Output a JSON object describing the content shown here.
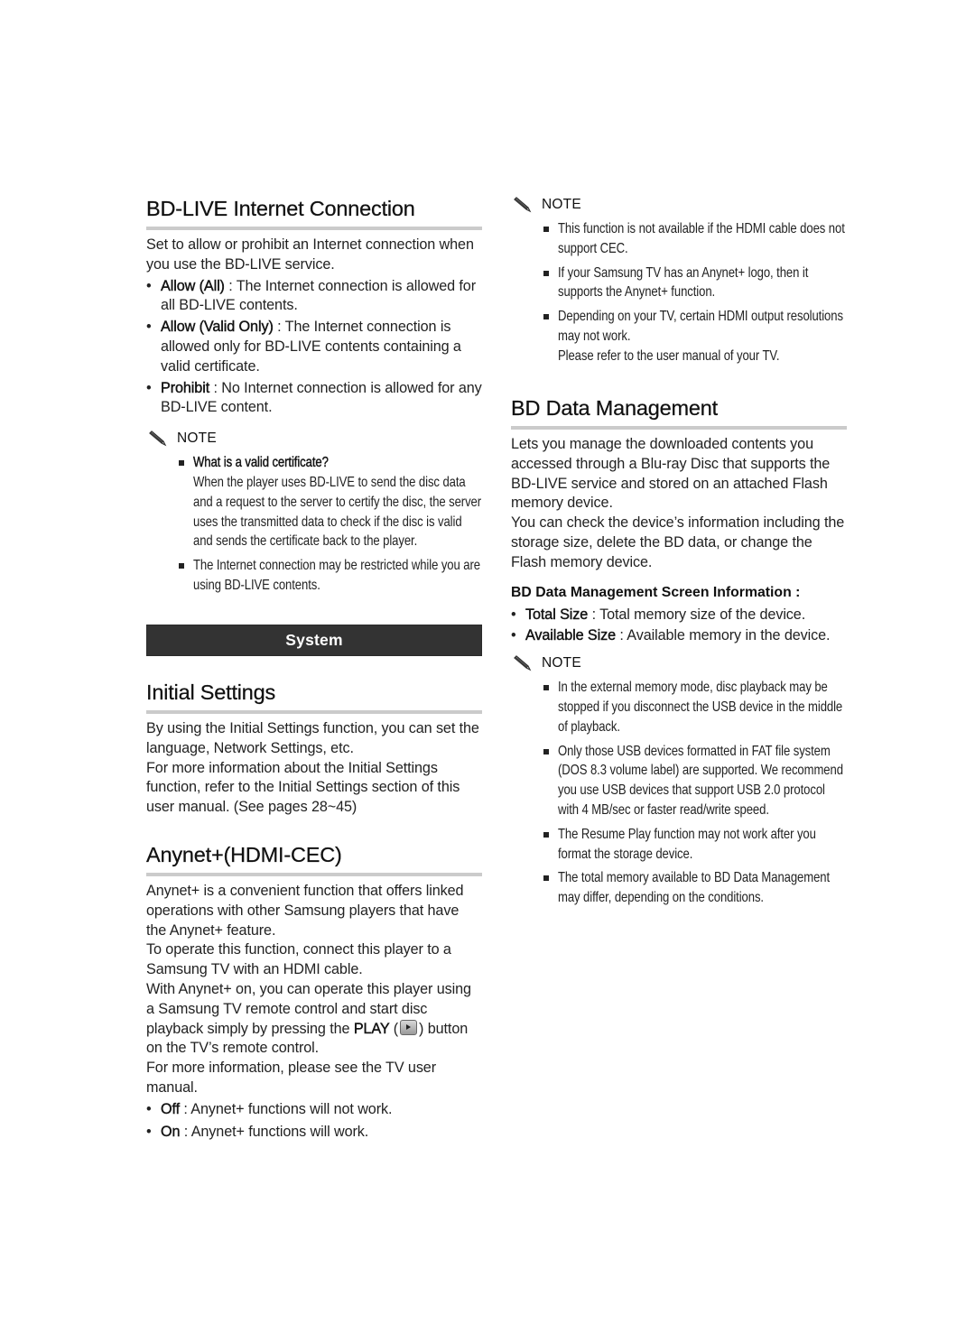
{
  "left": {
    "bdlive": {
      "title": "BD-LIVE Internet Connection",
      "intro": "Set to allow or prohibit an Internet connection when you use the BD-LIVE service.",
      "options": [
        {
          "term": "Allow (All)",
          "desc": " : The Internet connection is allowed for all BD-LIVE contents."
        },
        {
          "term": "Allow (Valid Only)",
          "desc": " : The Internet connection is allowed only for BD-LIVE contents containing a valid certificate."
        },
        {
          "term": "Prohibit",
          "desc": " : No Internet connection is allowed for any BD-LIVE content."
        }
      ],
      "note_label": "NOTE",
      "notes": [
        {
          "title": "What is a valid certificate?",
          "text": "When the player uses BD-LIVE to send the disc data and a request to the server to certify the disc, the server uses the transmitted data to check if the disc is valid and sends the certificate back to the player."
        },
        {
          "text": "The Internet connection may be restricted while you are using BD-LIVE contents."
        }
      ]
    },
    "system_bar": "System",
    "initial": {
      "title": "Initial Settings",
      "p1": "By using the Initial Settings function, you can set the language, Network Settings, etc.",
      "p2": "For more information about the Initial Settings function, refer to the Initial Settings section of this user manual. (See pages 28~45)"
    },
    "anynet": {
      "title": "Anynet+(HDMI-CEC)",
      "p1": "Anynet+ is a convenient function that offers linked operations with other Samsung players that have the Anynet+ feature.",
      "p2": "To operate this function, connect this player to a Samsung TV with an HDMI cable.",
      "p3_before": "With Anynet+ on, you can operate this player using a Samsung TV remote control and start disc playback simply by pressing the ",
      "p3_key": "PLAY",
      "p3_open": " (",
      "p3_close": ")",
      "p3_after": " button on the TV’s remote control.",
      "p4": "For more information, please see the TV user manual.",
      "options": [
        {
          "term": "Off",
          "desc": " : Anynet+ functions will not work."
        },
        {
          "term": "On",
          "desc": " : Anynet+ functions will work."
        }
      ]
    }
  },
  "right": {
    "anynet_note": {
      "note_label": "NOTE",
      "notes": [
        {
          "text": "This function is not available if the HDMI cable does not support CEC."
        },
        {
          "text": "If your Samsung TV has an Anynet+ logo, then it supports the Anynet+ function."
        },
        {
          "text": "Depending on your TV, certain HDMI output resolutions may not work.",
          "text2": "Please refer to the user manual of your TV."
        }
      ]
    },
    "bddata": {
      "title": "BD Data Management",
      "p1": "Lets you manage the downloaded contents you accessed through a Blu-ray Disc that supports the BD-LIVE service and stored on an attached Flash memory device.",
      "p2": "You can check the device’s information including the storage size, delete the BD data, or change the Flash memory device.",
      "subhead": "BD Data Management Screen Information :",
      "options": [
        {
          "term": "Total Size",
          "desc": " : Total memory size of the device."
        },
        {
          "term": "Available Size",
          "desc": " : Available memory in the device."
        }
      ],
      "note_label": "NOTE",
      "notes": [
        {
          "text": "In the external memory mode, disc playback may be stopped if you disconnect the USB device in the middle of playback."
        },
        {
          "text": "Only those USB devices formatted in FAT file system (DOS 8.3 volume label) are supported. We recommend you use USB devices that support USB 2.0 protocol with 4 MB/sec or faster read/write speed."
        },
        {
          "text": "The Resume Play function may not work after you format the storage device."
        },
        {
          "text": "The total memory available to BD Data Management may differ, depending on the conditions."
        }
      ]
    }
  }
}
